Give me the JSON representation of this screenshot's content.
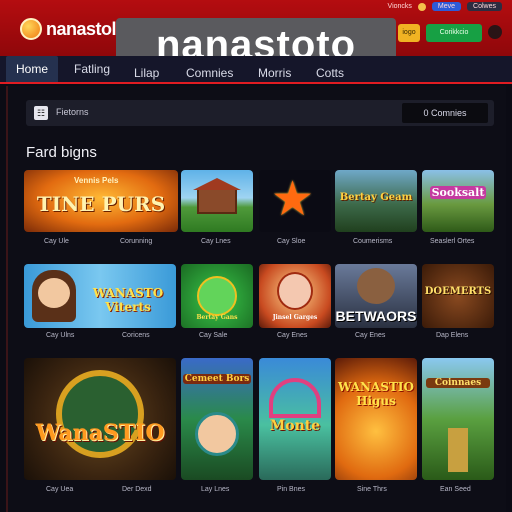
{
  "header": {
    "logo_text": "nanastol",
    "brand_banner": "nanastoto",
    "btn_yellow": "iogo",
    "btn_green": "Corikkcio",
    "top_links": [
      "Vioncks"
    ],
    "top_pill_blue": "Meve",
    "top_pill_dark": "Colwes"
  },
  "nav": {
    "items": [
      "Home",
      "Fatling",
      "Lilap",
      "Comnies",
      "Morris",
      "Cotts"
    ]
  },
  "filter_bar": {
    "label": "Fietorns",
    "count": "0 Comnies"
  },
  "section": {
    "title": "Fard bigns"
  },
  "games": {
    "row1": [
      {
        "title": "TINE PURS",
        "badge": "Vennis Pels",
        "cap_left": "Cay Ule",
        "cap_right": "Corunning"
      },
      {
        "title": "",
        "cap": "Cay Lnes"
      },
      {
        "title": "",
        "cap": "Cay Sloe"
      },
      {
        "title": "Bertay Geam",
        "cap": "Coumerisms"
      },
      {
        "title": "Sooksalt",
        "cap": "Seaslerl Ortes"
      }
    ],
    "row2": [
      {
        "title": "WANASTO Viterts",
        "cap_left": "Cay Ulns",
        "cap_right": "Coricens"
      },
      {
        "title": "Bertay Gans",
        "cap": "Cay Sale"
      },
      {
        "title": "Jinsel Garges",
        "cap": "Cay Enes"
      },
      {
        "title": "BETWAORS",
        "cap": "Cay Enes"
      },
      {
        "title": "DOEMERTS",
        "cap": "Dap Elens"
      }
    ],
    "row3": [
      {
        "title": "WanaSTIO",
        "cap_left": "Cay Uea",
        "cap_right": "Der Dexd"
      },
      {
        "title": "Cemeet Bors",
        "cap": "Lay Lnes"
      },
      {
        "title": "Monte",
        "cap": "Pin Bnes"
      },
      {
        "title": "WANASTIO Higus",
        "cap": "Sine Thrs"
      },
      {
        "title": "Coinnaes",
        "cap": "Ean Seed"
      }
    ]
  },
  "colors": {
    "topbar": "#a50b0e",
    "nav_underline": "#e01c22",
    "green_button": "#17a044",
    "yellow_button": "#f0b323"
  }
}
